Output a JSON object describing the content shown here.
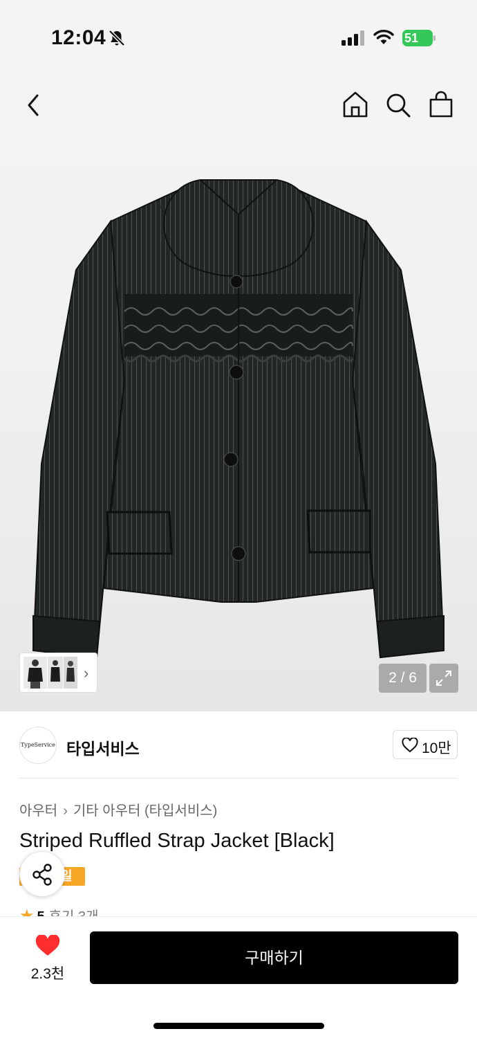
{
  "status_bar": {
    "time": "12:04",
    "battery_percent": "51",
    "icons": [
      "bell-slash-icon",
      "cellular-signal-icon",
      "wifi-icon",
      "battery-charging-icon"
    ]
  },
  "nav": {
    "icons": [
      "chevron-left-icon",
      "home-icon",
      "search-icon",
      "shopping-bag-icon"
    ]
  },
  "gallery": {
    "counter": "2 / 6",
    "current_image": 2,
    "total_images": 6
  },
  "brand": {
    "logo_text": "TypeService",
    "name": "타입서비스",
    "likes": "10만"
  },
  "breadcrumb": {
    "level1": "아우터",
    "level2": "기타 아우터 (타입서비스)"
  },
  "product": {
    "title": "Striped Ruffled Strap Jacket [Black]",
    "badge_visible_text": "일",
    "rating_score": "5",
    "reviews": "후기 3개"
  },
  "bottom": {
    "wishlist_count": "2.3천",
    "buy_label": "구매하기"
  },
  "colors": {
    "accent": "#f5a623",
    "battery": "#34c759",
    "heart": "#ff2d2d",
    "buy_button": "#000000"
  }
}
